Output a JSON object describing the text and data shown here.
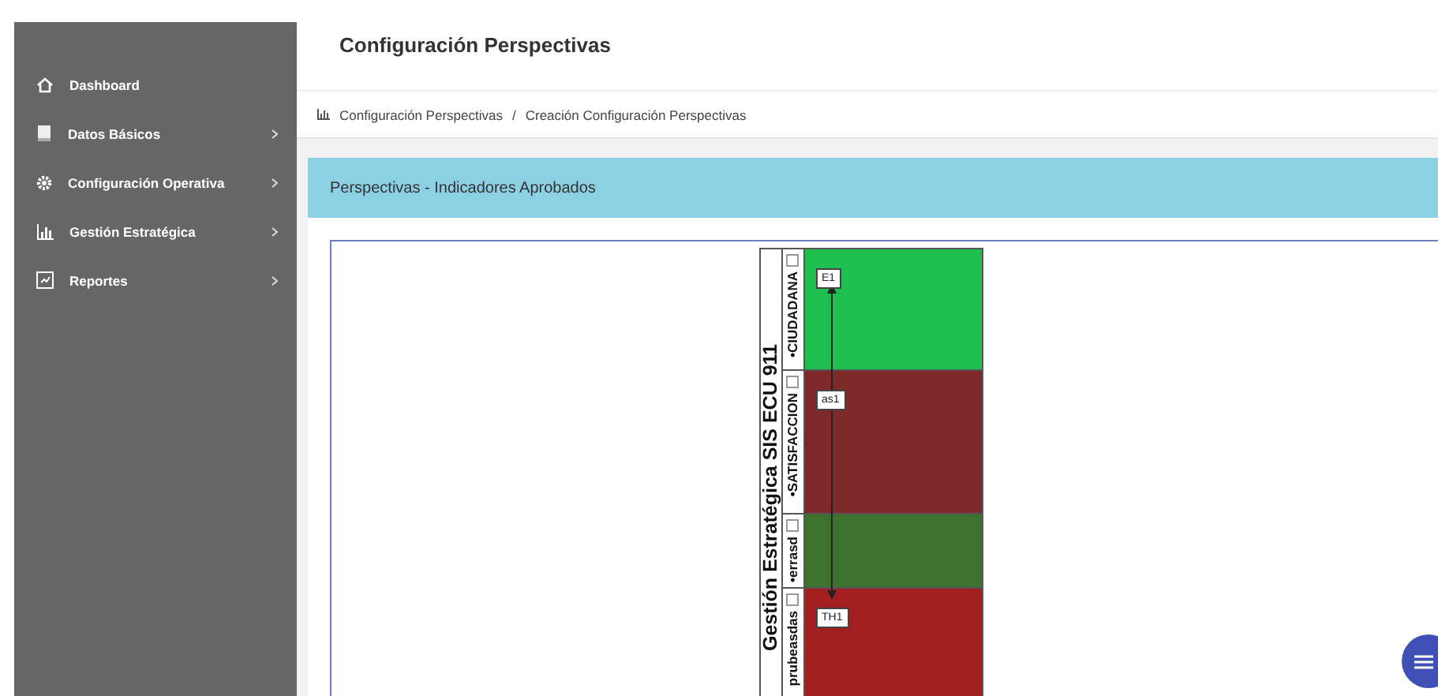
{
  "sidebar": {
    "items": [
      {
        "label": "Dashboard",
        "has_submenu": false
      },
      {
        "label": "Datos Básicos",
        "has_submenu": true
      },
      {
        "label": "Configuración Operativa",
        "has_submenu": true
      },
      {
        "label": "Gestión Estratégica",
        "has_submenu": true
      },
      {
        "label": "Reportes",
        "has_submenu": true
      }
    ]
  },
  "header": {
    "title": "Configuración Perspectivas"
  },
  "breadcrumb": {
    "items": [
      "Configuración Perspectivas",
      "Creación Configuración Perspectivas"
    ],
    "separator": "/"
  },
  "panel": {
    "title": "Perspectivas - Indicadores Aprobados"
  },
  "diagram": {
    "pool_title": "Gestión Estratégica SIS ECU 911",
    "lanes": [
      {
        "label": "•CIUDADANA",
        "color": "#1fbf4f",
        "nodes": [
          "E1"
        ]
      },
      {
        "label": "•SATISFACCION",
        "color": "#7f2a2a",
        "nodes": [
          "as1"
        ]
      },
      {
        "label": "•errasd",
        "color": "#3d722e"
      },
      {
        "label": "prubeasdas",
        "color": "#a31f1f",
        "nodes": [
          "TH1"
        ]
      }
    ]
  }
}
